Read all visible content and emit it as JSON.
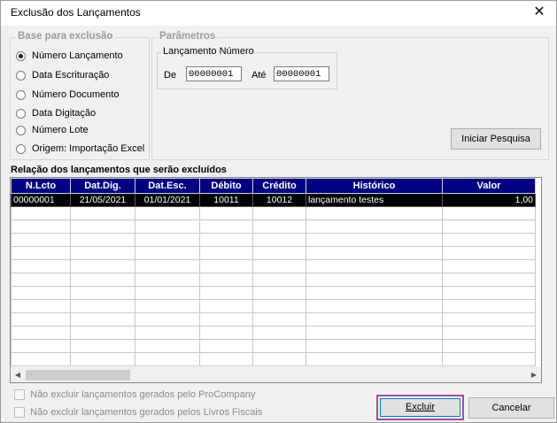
{
  "window": {
    "title": "Exclusão dos Lançamentos",
    "close_symbol": "✕"
  },
  "base": {
    "label": "Base para exclusão",
    "options": [
      {
        "label": "Número Lançamento",
        "checked": true
      },
      {
        "label": "Data Escrituração",
        "checked": false
      },
      {
        "label": "Número Documento",
        "checked": false
      },
      {
        "label": "Data Digitação",
        "checked": false
      },
      {
        "label": "Número Lote",
        "checked": false
      },
      {
        "label": "Origem: Importação Excel",
        "checked": false
      }
    ]
  },
  "params": {
    "label": "Parâmetros",
    "sub_label": "Lançamento Número",
    "from_label": "De",
    "from_value": "00000001",
    "to_label": "Até",
    "to_value": "00000001",
    "search_button": "Iniciar Pesquisa"
  },
  "list": {
    "title": "Relação dos lançamentos que serão excluídos",
    "columns": [
      "N.Lcto",
      "Dat.Dig.",
      "Dat.Esc.",
      "Débito",
      "Crédito",
      "Histórico",
      "Valor"
    ],
    "rows": [
      [
        "00000001",
        "21/05/2021",
        "01/01/2021",
        "10011",
        "10012",
        "lançamento testes",
        "1,00"
      ]
    ]
  },
  "options": {
    "exclude_procompany": "Não excluir lançamentos gerados pelo ProCompany",
    "exclude_livros": "Não excluir lançamentos gerados pelos Livros Fiscais"
  },
  "buttons": {
    "excluir": "Excluir",
    "cancelar": "Cancelar"
  },
  "colors": {
    "header_bg": "#000080",
    "selected_row_bg": "#000000",
    "highlight_border": "#a050a0"
  }
}
